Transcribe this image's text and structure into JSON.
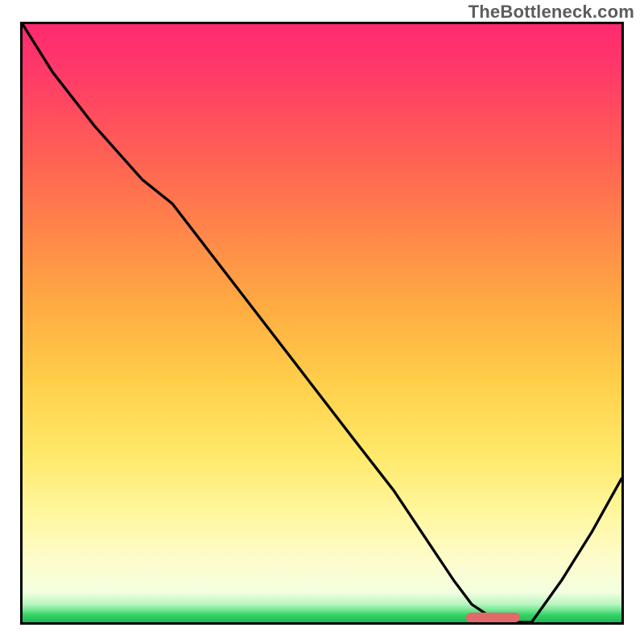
{
  "watermark": "TheBottleneck.com",
  "accent_color": "#e06a6a",
  "chart_data": {
    "type": "line",
    "title": "",
    "xlabel": "",
    "ylabel": "",
    "xlim": [
      0,
      100
    ],
    "ylim": [
      0,
      100
    ],
    "series": [
      {
        "name": "curve",
        "x": [
          0,
          5,
          12,
          20,
          25,
          35,
          45,
          55,
          62,
          68,
          72,
          75,
          78,
          80,
          85,
          90,
          95,
          100
        ],
        "y": [
          100,
          92,
          83,
          74,
          70,
          57,
          44,
          31,
          22,
          13,
          7,
          3,
          1,
          0,
          0,
          7,
          15,
          24
        ]
      }
    ],
    "accent_segment": {
      "x_start": 74,
      "x_end": 83,
      "y": 0.8
    }
  }
}
